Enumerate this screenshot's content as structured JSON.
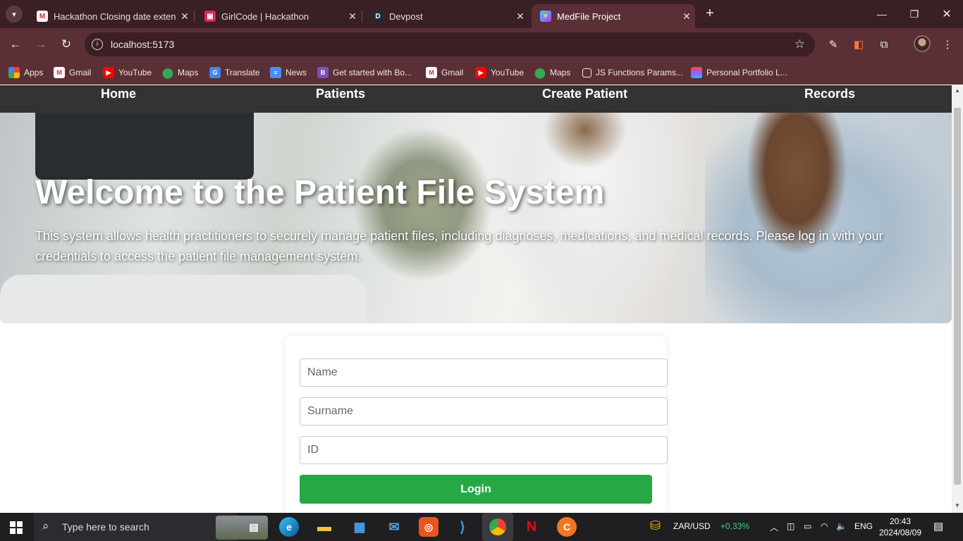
{
  "browser": {
    "tabs": [
      {
        "title": "Hackathon Closing date extensi",
        "icon": "gmail-icon"
      },
      {
        "title": "GirlCode | Hackathon",
        "icon": "girlcode-icon"
      },
      {
        "title": "Devpost",
        "icon": "devpost-icon"
      },
      {
        "title": "MedFile Project",
        "icon": "vite-icon",
        "active": true
      }
    ],
    "url": "localhost:5173",
    "bookmarks": [
      {
        "label": "Apps"
      },
      {
        "label": "Gmail"
      },
      {
        "label": "YouTube"
      },
      {
        "label": "Maps"
      },
      {
        "label": "Translate"
      },
      {
        "label": "News"
      },
      {
        "label": "Get started with Bo..."
      },
      {
        "label": "Gmail"
      },
      {
        "label": "YouTube"
      },
      {
        "label": "Maps"
      },
      {
        "label": "JS Functions Params..."
      },
      {
        "label": "Personal Portfolio L..."
      }
    ]
  },
  "site": {
    "nav": {
      "home": "Home",
      "patients": "Patients",
      "create_patient": "Create Patient",
      "records": "Records"
    },
    "hero": {
      "title": "Welcome to the Patient File System",
      "text": "This system allows health practitioners to securely manage patient files, including diagnoses, medications, and medical records. Please log in with your credentials to access the patient file management system."
    },
    "login": {
      "name_placeholder": "Name",
      "surname_placeholder": "Surname",
      "id_placeholder": "ID",
      "button": "Login"
    }
  },
  "taskbar": {
    "search_placeholder": "Type here to search",
    "ticker": "ZAR/USD",
    "ticker_change": "+0,33%",
    "language": "ENG",
    "time": "20:43",
    "date": "2024/08/09"
  },
  "colors": {
    "tab_strip": "#3a1f24",
    "toolbar": "#5b2f36",
    "site_nav": "#333333",
    "login_button": "#28a745",
    "ticker_positive": "#3fd07a"
  }
}
